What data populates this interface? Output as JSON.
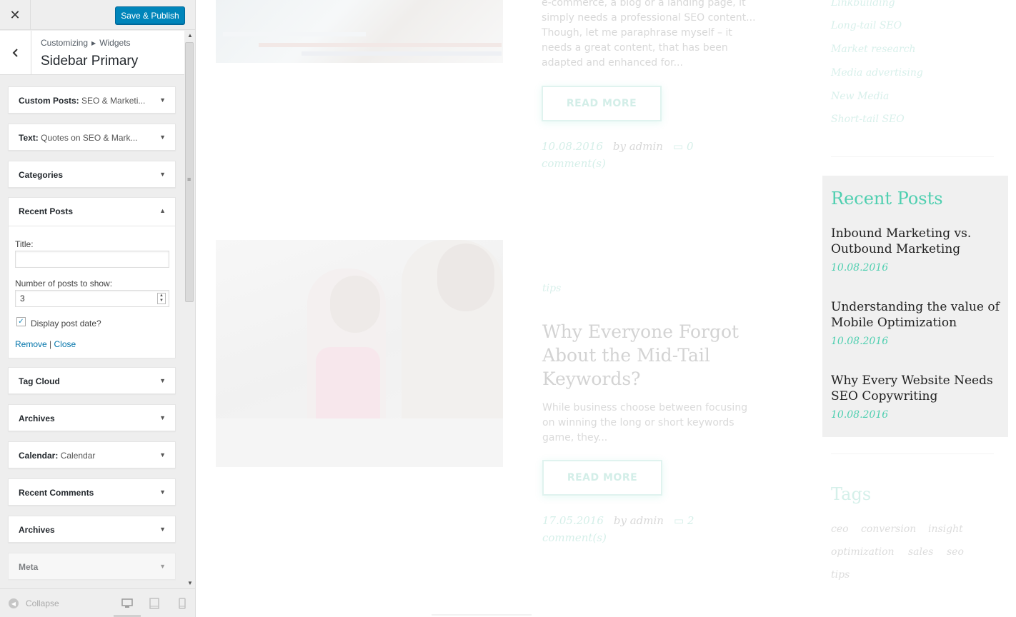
{
  "customizer": {
    "close_icon": "close-icon",
    "publish_label": "Save & Publish",
    "breadcrumb": [
      "Customizing",
      "Widgets"
    ],
    "section_title": "Sidebar Primary",
    "widgets": [
      {
        "title": "Custom Posts:",
        "subtitle": "SEO & Marketi..."
      },
      {
        "title": "Text:",
        "subtitle": "Quotes on SEO & Mark..."
      },
      {
        "title": "Categories",
        "subtitle": ""
      },
      {
        "title": "Tag Cloud",
        "subtitle": ""
      },
      {
        "title": "Archives",
        "subtitle": ""
      },
      {
        "title": "Calendar:",
        "subtitle": "Calendar"
      },
      {
        "title": "Recent Comments",
        "subtitle": ""
      },
      {
        "title": "Archives",
        "subtitle": ""
      },
      {
        "title": "Meta",
        "subtitle": ""
      }
    ],
    "recent_posts_widget": {
      "title": "Recent Posts",
      "title_field_label": "Title:",
      "title_field_value": "",
      "count_label": "Number of posts to show:",
      "count_value": "3",
      "show_date_label": "Display post date?",
      "show_date_checked": true,
      "remove_label": "Remove",
      "close_label": "Close"
    },
    "footer": {
      "collapse_label": "Collapse",
      "devices": [
        "desktop-icon",
        "tablet-icon",
        "mobile-icon"
      ]
    }
  },
  "preview": {
    "post1": {
      "excerpt": "e-commerce, a blog or a landing page, it simply needs a professional SEO content... Though, let me paraphrase myself – it needs a great content, that has been adapted and enhanced for...",
      "read_more": "READ MORE",
      "date": "10.08.2016",
      "author": "by admin",
      "comments": "0",
      "comments_label": "comment(s)"
    },
    "post2": {
      "tag": "tips",
      "title": "Why Everyone Forgot About the Mid-Tail Keywords?",
      "excerpt": "While business choose between focusing on winning the long or short keywords game, they...",
      "read_more": "READ MORE",
      "date": "17.05.2016",
      "author": "by admin",
      "comments": "2",
      "comments_label": "comment(s)"
    },
    "categories": [
      "Linkbuilding",
      "Long-tail SEO",
      "Market research",
      "Media advertising",
      "New Media",
      "Short-tail SEO"
    ],
    "recent_posts": {
      "title": "Recent Posts",
      "items": [
        {
          "title": "Inbound Marketing vs. Outbound Marketing",
          "date": "10.08.2016"
        },
        {
          "title": "Understanding the value of Mobile Optimization",
          "date": "10.08.2016"
        },
        {
          "title": "Why Every Website Needs SEO Copywriting",
          "date": "10.08.2016"
        }
      ]
    },
    "tags": {
      "title": "Tags",
      "items": [
        "ceo",
        "conversion",
        "insight",
        "optimization",
        "sales",
        "seo",
        "tips"
      ]
    }
  },
  "colors": {
    "accent": "#4fcfb0",
    "wp_blue": "#0085ba",
    "link_blue": "#0073aa"
  }
}
